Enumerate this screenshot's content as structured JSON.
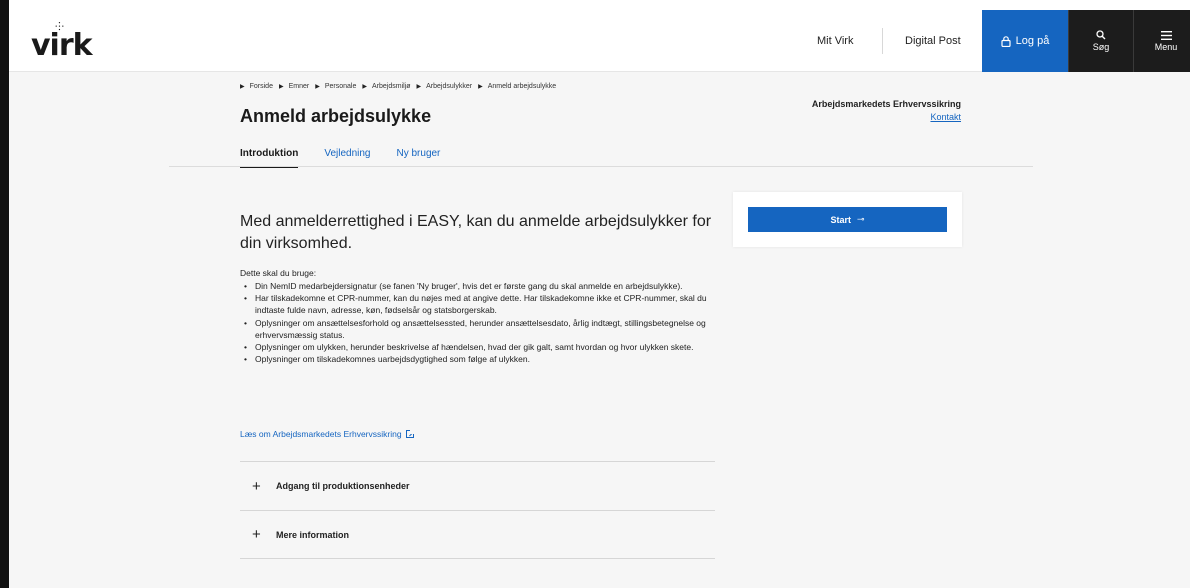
{
  "header": {
    "logo_text": "virk",
    "nav_mit": "Mit Virk",
    "nav_post": "Digital Post",
    "login_label": "Log på",
    "search_label": "Søg",
    "menu_label": "Menu"
  },
  "breadcrumb": [
    "Forside",
    "Emner",
    "Personale",
    "Arbejdsmiljø",
    "Arbejdsulykker",
    "Anmeld arbejdsulykke"
  ],
  "page": {
    "title": "Anmeld arbejdsulykke",
    "org_name": "Arbejdsmarkedets Erhvervssikring",
    "org_contact": "Kontakt"
  },
  "tabs": [
    {
      "label": "Introduktion",
      "active": true
    },
    {
      "label": "Vejledning",
      "active": false
    },
    {
      "label": "Ny bruger",
      "active": false
    }
  ],
  "content": {
    "lead": "Med anmelderrettighed i EASY, kan du anmelde arbejdsulykker for din virksomhed.",
    "intro": "Dette skal du bruge:",
    "bullets": [
      "Din NemID medarbejdersignatur (se fanen 'Ny bruger', hvis det er første gang du skal anmelde en arbejdsulykke).",
      "Har tilskadekomne et CPR-nummer, kan du nøjes med at angive dette. Har tilskadekomne ikke et CPR-nummer, skal du indtaste fulde navn, adresse, køn, fødselsår og statsborgerskab.",
      "Oplysninger om ansættelsesforhold og ansættelsessted, herunder ansættelsesdato, årlig indtægt, stillingsbetegnelse og erhvervsmæssig status.",
      "Oplysninger om ulykken, herunder beskrivelse af hændelsen, hvad der gik galt, samt hvordan og hvor ulykken skete.",
      "Oplysninger om tilskadekomnes uarbejdsdygtighed som følge af ulykken."
    ],
    "read_link": "Læs om Arbejdsmarkedets Erhvervssikring",
    "accordion": [
      "Adgang til produktionsenheder",
      "Mere information"
    ]
  },
  "start": {
    "label": "Start"
  },
  "colors": {
    "accent": "#1565c0",
    "dark": "#1c1c1c",
    "band": "#f6f6f6"
  }
}
